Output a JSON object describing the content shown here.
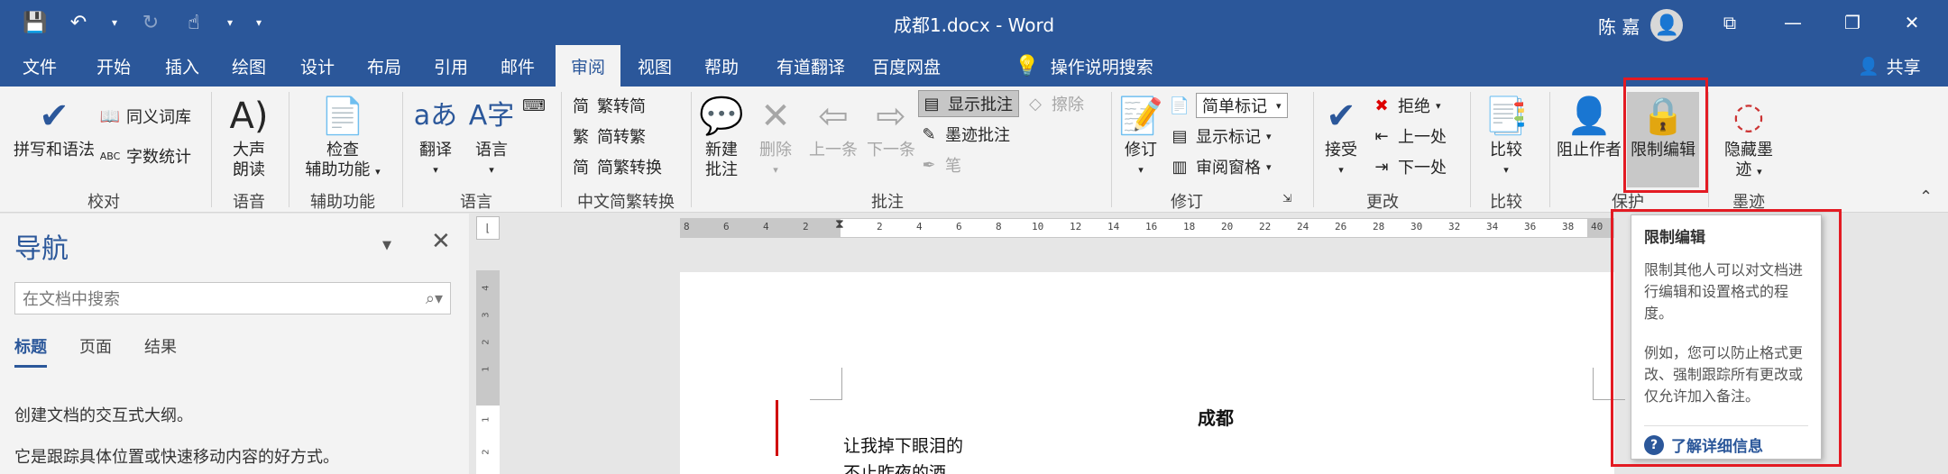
{
  "title_bar": {
    "document_title": "成都1.docx - Word",
    "user_name": "陈 嘉",
    "icons": [
      "save-icon",
      "undo-icon",
      "redo-icon",
      "touch-mode-icon",
      "customize-qat-icon"
    ]
  },
  "menu": {
    "tabs": [
      "文件",
      "开始",
      "插入",
      "绘图",
      "设计",
      "布局",
      "引用",
      "邮件",
      "审阅",
      "视图",
      "帮助",
      "有道翻译",
      "百度网盘"
    ],
    "active_tab": "审阅",
    "tell_me": "操作说明搜索",
    "share": "共享"
  },
  "ribbon": {
    "proofing": {
      "spelling": "拼写和语法",
      "thesaurus": "同义词库",
      "word_count": "字数统计",
      "group": "校对"
    },
    "speech": {
      "read_aloud_1": "大声",
      "read_aloud_2": "朗读",
      "group": "语音"
    },
    "accessibility": {
      "check_1": "检查",
      "check_2": "辅助功能",
      "group": "辅助功能"
    },
    "language": {
      "translate": "翻译",
      "language": "语言",
      "group": "语言"
    },
    "chinese_conversion": {
      "to_traditional": "繁转简",
      "to_simplified": "简转繁",
      "convert": "简繁转换",
      "group": "中文简繁转换"
    },
    "comments": {
      "new_1": "新建",
      "new_2": "批注",
      "delete": "删除",
      "previous": "上一条",
      "next": "下一条",
      "show_comments": "显示批注",
      "erase": "擦除",
      "ink_comments": "墨迹批注",
      "pen": "笔",
      "group": "批注"
    },
    "tracking": {
      "track": "修订",
      "markup_dropdown": "简单标记",
      "show_markup": "显示标记",
      "reviewing_pane": "审阅窗格",
      "group": "修订"
    },
    "changes": {
      "accept": "接受",
      "reject": "拒绝",
      "previous": "上一处",
      "next": "下一处",
      "group": "更改"
    },
    "compare": {
      "compare": "比较",
      "group": "比较"
    },
    "protect": {
      "block_authors": "阻止作者",
      "restrict_editing": "限制编辑",
      "group": "保护"
    },
    "ink": {
      "hide_ink_1": "隐藏墨",
      "hide_ink_2": "迹",
      "group": "墨迹"
    }
  },
  "navigation": {
    "title": "导航",
    "search_placeholder": "在文档中搜索",
    "tabs": [
      "标题",
      "页面",
      "结果"
    ],
    "text_1": "创建文档的交互式大纲。",
    "text_2": "它是跟踪具体位置或快速移动内容的好方式。"
  },
  "ruler": {
    "ticks": [
      "8",
      "6",
      "4",
      "2",
      "2",
      "4",
      "6",
      "8",
      "10",
      "12",
      "14",
      "16",
      "18",
      "20",
      "22",
      "24",
      "26",
      "28",
      "30",
      "32",
      "34",
      "36",
      "38",
      "40"
    ],
    "vertical_ticks": [
      "4",
      "3",
      "2",
      "1",
      "1",
      "2"
    ]
  },
  "document": {
    "heading": "成都",
    "line_1": "让我掉下眼泪的",
    "line_2": "不止昨夜的酒"
  },
  "tooltip": {
    "title": "限制编辑",
    "body_1": "限制其他人可以对文档进行编辑和设置格式的程度。",
    "body_2": "例如，您可以防止格式更改、强制跟踪所有更改或仅允许加入备注。",
    "link": "了解详细信息"
  },
  "colors": {
    "brand": "#2b579a",
    "ribbon_bg": "#f3f3f3",
    "highlight": "#e31b23",
    "revision_bar": "#d00000"
  }
}
